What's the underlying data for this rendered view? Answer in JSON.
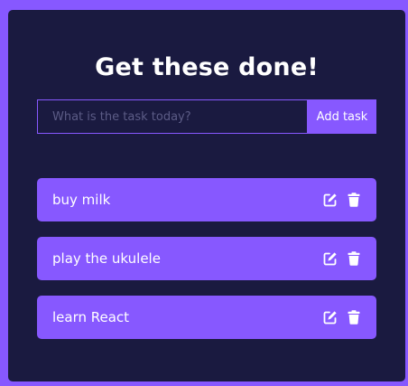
{
  "header": {
    "title": "Get these done!"
  },
  "form": {
    "placeholder": "What is the task today?",
    "value": "",
    "submit_label": "Add task"
  },
  "todos": [
    {
      "text": "buy milk",
      "edit_icon": "edit-icon",
      "delete_icon": "trash-icon"
    },
    {
      "text": "play the ukulele",
      "edit_icon": "edit-icon",
      "delete_icon": "trash-icon"
    },
    {
      "text": "learn React",
      "edit_icon": "edit-icon",
      "delete_icon": "trash-icon"
    }
  ],
  "colors": {
    "page_background": "#8758ff",
    "card_background": "#1a1a40",
    "accent": "#8758ff",
    "text": "#ffffff",
    "placeholder": "#5c5c86"
  }
}
